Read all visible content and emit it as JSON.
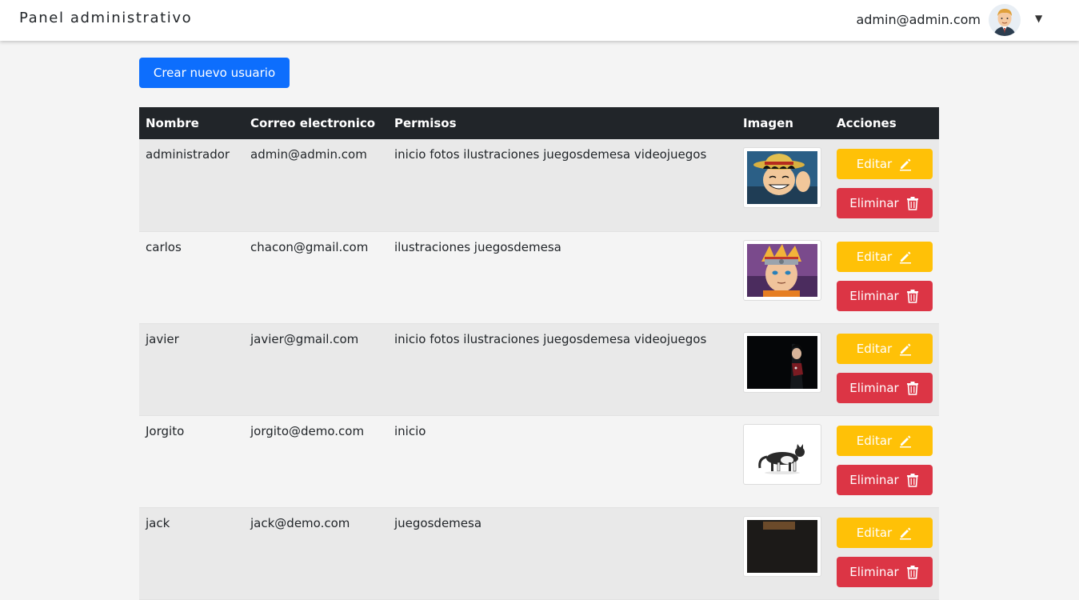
{
  "navbar": {
    "brand": "Panel administrativo",
    "user_email": "admin@admin.com",
    "avatar_icon": "avatar-icon",
    "caret": "▼"
  },
  "actions": {
    "create_label": "Crear nuevo usuario"
  },
  "table": {
    "headers": [
      "Nombre",
      "Correo electronico",
      "Permisos",
      "Imagen",
      "Acciones"
    ],
    "edit_label": "Editar",
    "delete_label": "Eliminar",
    "rows": [
      {
        "name": "administrador",
        "email": "admin@admin.com",
        "permissions": "inicio fotos ilustraciones juegosdemesa videojuegos",
        "image": "luffy-image"
      },
      {
        "name": "carlos",
        "email": "chacon@gmail.com",
        "permissions": "ilustraciones juegosdemesa",
        "image": "naruto-image"
      },
      {
        "name": "javier",
        "email": "javier@gmail.com",
        "permissions": "inicio fotos ilustraciones juegosdemesa videojuegos",
        "image": "itachi-image"
      },
      {
        "name": "Jorgito",
        "email": "jorgito@demo.com",
        "permissions": "inicio",
        "image": "cat-image"
      },
      {
        "name": "jack",
        "email": "jack@demo.com",
        "permissions": "juegosdemesa",
        "image": "dark-image"
      }
    ]
  },
  "colors": {
    "primary": "#0d6efd",
    "warning": "#ffc107",
    "danger": "#dc3545",
    "header_dark": "#212529"
  }
}
